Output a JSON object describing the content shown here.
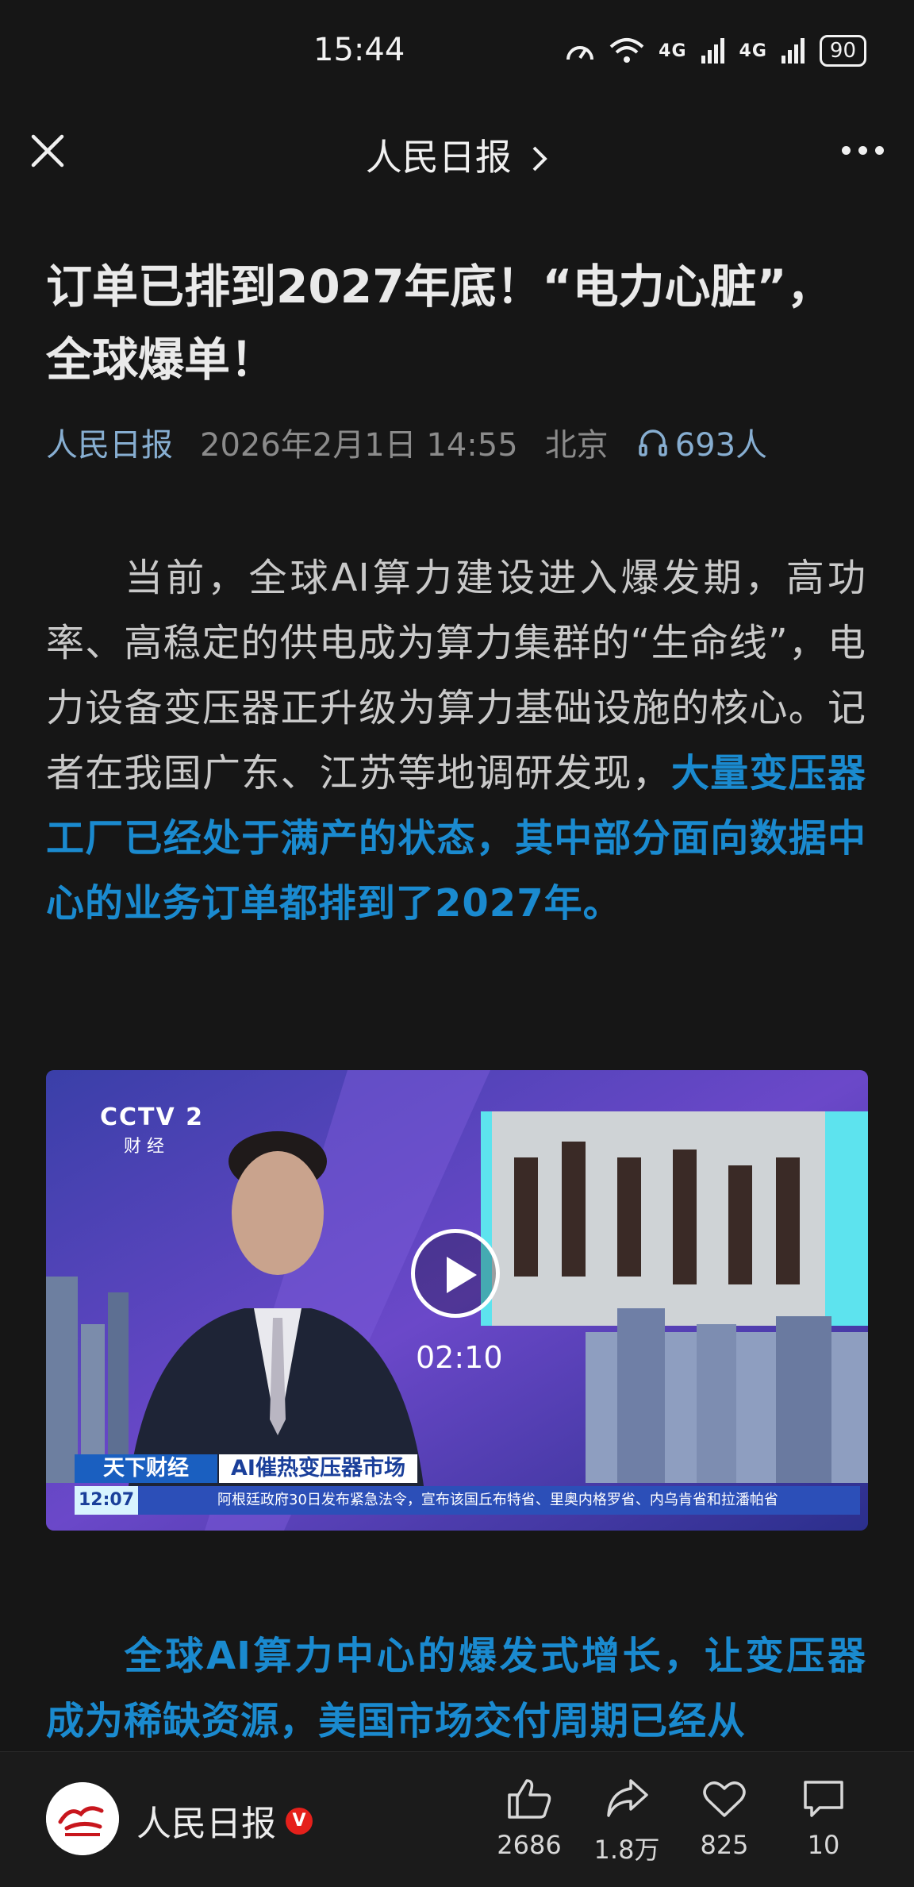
{
  "status": {
    "time": "15:44",
    "battery": "90",
    "network1": "4G",
    "network2": "4G"
  },
  "nav": {
    "title": "人民日报"
  },
  "article": {
    "title": "订单已排到2027年底！“电力心脏”，全球爆单！",
    "source": "人民日报",
    "date": "2026年2月1日 14:55",
    "location": "北京",
    "listeners": "693人",
    "p1_plain": "当前，全球AI算力建设进入爆发期，高功率、高稳定的供电成为算力集群的“生命线”，电力设备变压器正升级为算力基础设施的核心。记者在我国广东、江苏等地调研发现，",
    "p1_highlight": "大量变压器工厂已经处于满产的状态，其中部分面向数据中心的业务订单都排到了2027年。",
    "p2_highlight": "全球AI算力中心的爆发式增长，让变压器成为稀缺资源，美国市场交付周期已经从"
  },
  "video": {
    "duration": "02:10",
    "logo": "CCTV 2",
    "channel": "财 经",
    "program": "天下财经",
    "headline": "AI催热变压器市场",
    "ticker_time": "12:07",
    "ticker_text": "阿根廷政府30日发布紧急法令，宣布该国丘布特省、里奥内格罗省、内乌肯省和拉潘帕省"
  },
  "bottom": {
    "account": "人民日报",
    "verified": "V",
    "likes": "2686",
    "shares": "1.8万",
    "favorites": "825",
    "comments": "10"
  },
  "colors": {
    "background": "#161616",
    "accent_blue": "#1a8acf",
    "meta_blue": "#87aed1",
    "verified_red": "#e5201b"
  }
}
